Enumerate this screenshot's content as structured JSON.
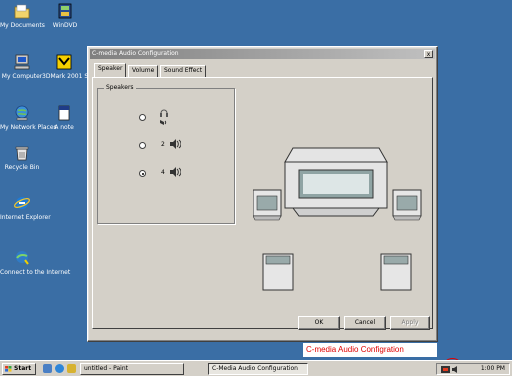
{
  "desktop": {
    "icons": [
      {
        "label": "My Documents",
        "icon": "folder-icon"
      },
      {
        "label": "WinDVD",
        "icon": "dvd-player-icon"
      },
      {
        "label": "My Computer",
        "icon": "computer-icon"
      },
      {
        "label": "3DMark 2001 SE",
        "icon": "benchmark-icon"
      },
      {
        "label": "My Network Places",
        "icon": "network-icon"
      },
      {
        "label": "A note",
        "icon": "document-icon"
      },
      {
        "label": "Recycle Bin",
        "icon": "recycle-bin-icon"
      },
      {
        "label": "Internet Explorer",
        "icon": "internet-explorer-icon"
      },
      {
        "label": "Connect to the Internet",
        "icon": "connect-internet-icon"
      }
    ]
  },
  "dialog": {
    "title": "C-media Audio Configuration",
    "close_label": "x",
    "tabs": [
      {
        "label": "Speaker"
      },
      {
        "label": "Volume"
      },
      {
        "label": "Sound Effect"
      }
    ],
    "group_label": "Speakers",
    "options": [
      {
        "label": "2",
        "checked": false
      },
      {
        "label": "4",
        "checked": false
      },
      {
        "label": "4",
        "checked": true
      }
    ],
    "buttons": {
      "ok": "OK",
      "cancel": "Cancel",
      "apply": "Apply"
    }
  },
  "taskbar": {
    "start_label": "Start",
    "tasks": [
      {
        "label": "untitled - Paint"
      },
      {
        "label": "C-Media Audio Configuration"
      }
    ],
    "clock": "1:00 PM"
  },
  "annotation": {
    "text": "C-media Audio Configration",
    "color": "#e00000"
  },
  "colors": {
    "desktop": "#3a6ea5",
    "dialog_face": "#d4d0c8",
    "titlebar_inactive": "#808080"
  }
}
